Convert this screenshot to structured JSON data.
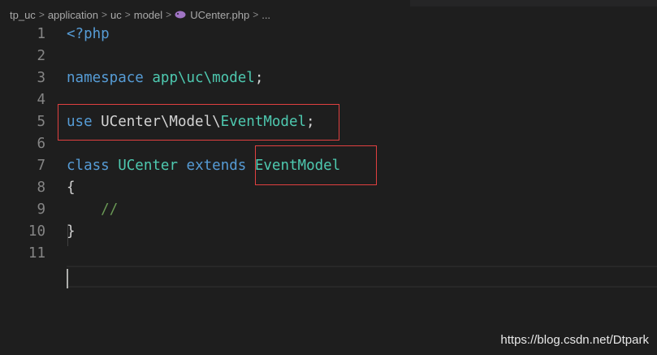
{
  "breadcrumb": {
    "items": [
      "tp_uc",
      "application",
      "uc",
      "model",
      "UCenter.php",
      "..."
    ],
    "separator": ">"
  },
  "editor": {
    "lines": [
      {
        "number": "1",
        "tokens": [
          {
            "text": "<?php",
            "kind": "tag"
          }
        ]
      },
      {
        "number": "2",
        "tokens": []
      },
      {
        "number": "3",
        "tokens": [
          {
            "text": "namespace",
            "kind": "kw"
          },
          {
            "text": " ",
            "kind": "plain"
          },
          {
            "text": "app\\uc\\model",
            "kind": "ns"
          },
          {
            "text": ";",
            "kind": "plain"
          }
        ]
      },
      {
        "number": "4",
        "tokens": []
      },
      {
        "number": "5",
        "tokens": [
          {
            "text": "use",
            "kind": "kw"
          },
          {
            "text": " UCenter\\Model\\",
            "kind": "plain"
          },
          {
            "text": "EventModel",
            "kind": "cls"
          },
          {
            "text": ";",
            "kind": "plain"
          }
        ]
      },
      {
        "number": "6",
        "tokens": []
      },
      {
        "number": "7",
        "tokens": [
          {
            "text": "class",
            "kind": "kw"
          },
          {
            "text": " ",
            "kind": "plain"
          },
          {
            "text": "UCenter",
            "kind": "cls"
          },
          {
            "text": " ",
            "kind": "plain"
          },
          {
            "text": "extends",
            "kind": "kw"
          },
          {
            "text": " ",
            "kind": "plain"
          },
          {
            "text": "EventModel",
            "kind": "cls"
          }
        ]
      },
      {
        "number": "8",
        "tokens": [
          {
            "text": "{",
            "kind": "plain"
          }
        ]
      },
      {
        "number": "9",
        "tokens": [
          {
            "text": "    ",
            "kind": "plain"
          },
          {
            "text": "//",
            "kind": "cmt"
          }
        ]
      },
      {
        "number": "10",
        "tokens": [
          {
            "text": "}",
            "kind": "plain"
          }
        ]
      },
      {
        "number": "11",
        "tokens": []
      }
    ]
  },
  "icons": {
    "file": "php-elephant-icon",
    "separator": "chevron-right-icon"
  },
  "colors": {
    "background": "#1e1e1e",
    "keyword": "#569cd6",
    "type": "#4ec9b0",
    "comment": "#6a9955",
    "text": "#d4d4d4",
    "line_number": "#858585",
    "highlight_box": "#e04040"
  },
  "watermark": "https://blog.csdn.net/Dtpark"
}
